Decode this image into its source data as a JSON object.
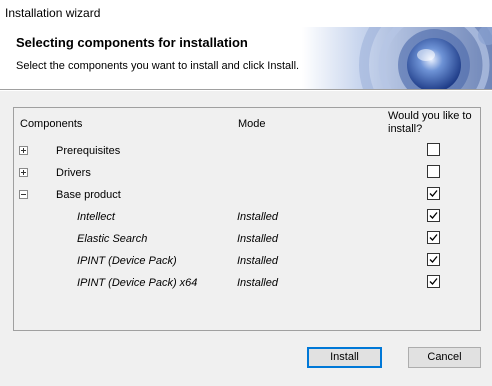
{
  "window": {
    "title": "Installation wizard"
  },
  "header": {
    "heading": "Selecting components for installation",
    "subtitle": "Select the components you want to install and click Install."
  },
  "table": {
    "columns": {
      "components": "Components",
      "mode": "Mode",
      "install": "Would you like to install?"
    },
    "rows": [
      {
        "name": "Prerequisites",
        "mode": "",
        "level": 0,
        "expander": "plus",
        "checked": false
      },
      {
        "name": "Drivers",
        "mode": "",
        "level": 0,
        "expander": "plus",
        "checked": false
      },
      {
        "name": "Base product",
        "mode": "",
        "level": 0,
        "expander": "minus",
        "checked": true
      },
      {
        "name": "Intellect",
        "mode": "Installed",
        "level": 1,
        "expander": "none",
        "checked": true
      },
      {
        "name": "Elastic Search",
        "mode": "Installed",
        "level": 1,
        "expander": "none",
        "checked": true
      },
      {
        "name": "IPINT (Device Pack)",
        "mode": "Installed",
        "level": 1,
        "expander": "none",
        "checked": true
      },
      {
        "name": "IPINT (Device Pack) x64",
        "mode": "Installed",
        "level": 1,
        "expander": "none",
        "checked": true
      }
    ]
  },
  "buttons": {
    "install": "Install",
    "cancel": "Cancel"
  },
  "colors": {
    "accent": "#0078d7",
    "banner": "#3a5fb0"
  }
}
